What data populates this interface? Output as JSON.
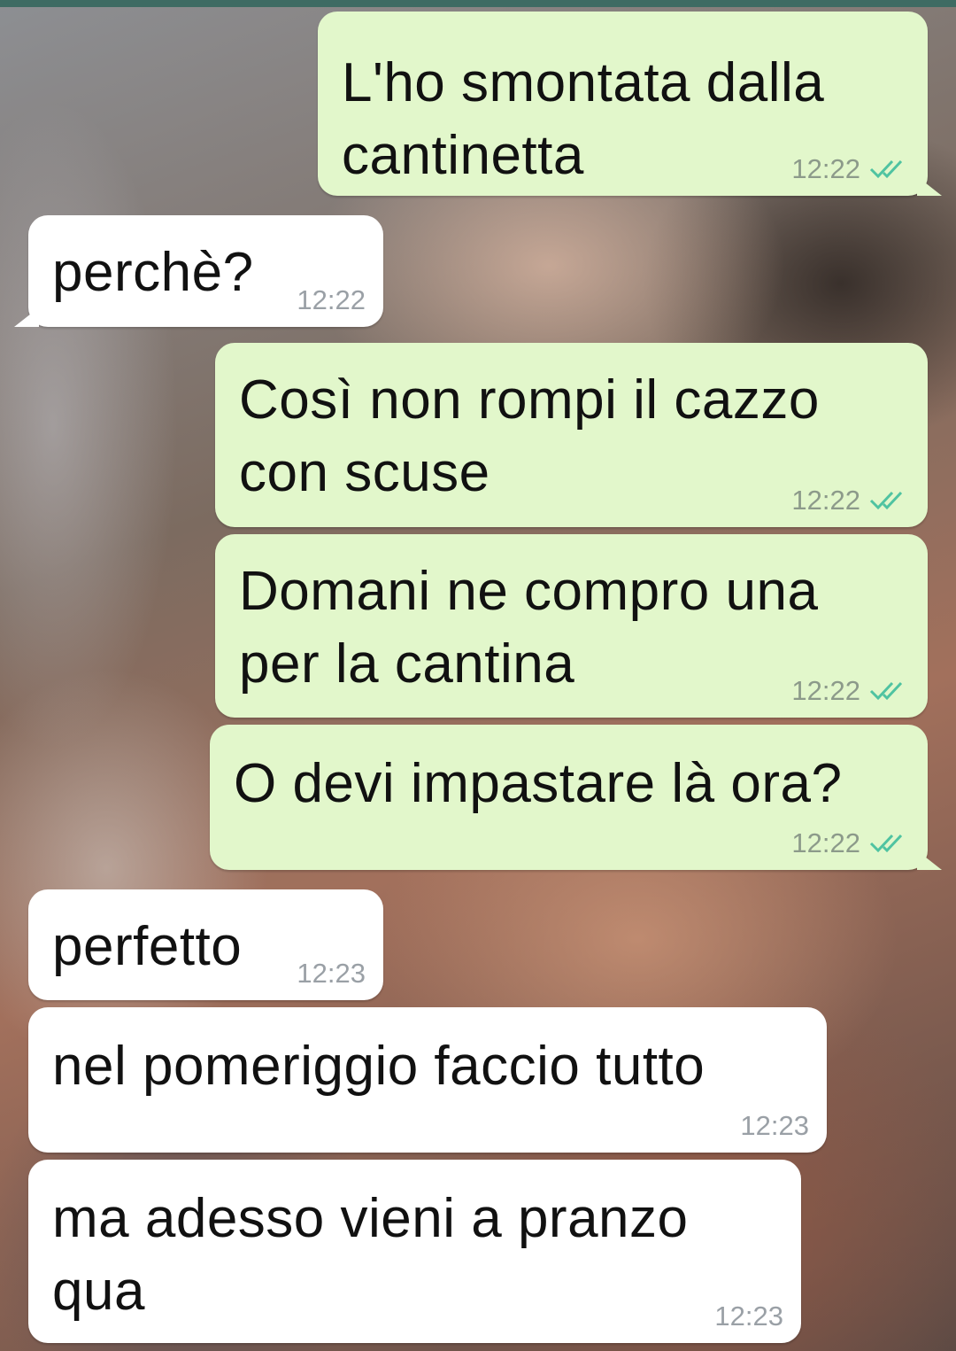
{
  "chat": {
    "messages": [
      {
        "direction": "outgoing",
        "text": "L'ho smontata dalla\ncantinetta",
        "time": "12:22",
        "status": "read-double-check-icon"
      },
      {
        "direction": "incoming",
        "text": "perchè?",
        "time": "12:22"
      },
      {
        "direction": "outgoing",
        "text": "Così non rompi il cazzo\ncon scuse",
        "time": "12:22",
        "status": "read-double-check-icon"
      },
      {
        "direction": "outgoing",
        "text": "Domani ne compro una\nper la cantina",
        "time": "12:22",
        "status": "read-double-check-icon"
      },
      {
        "direction": "outgoing",
        "text": "O devi impastare là ora?",
        "time": "12:22",
        "status": "read-double-check-icon"
      },
      {
        "direction": "incoming",
        "text": "perfetto",
        "time": "12:23"
      },
      {
        "direction": "incoming",
        "text": "nel pomeriggio faccio tutto",
        "time": "12:23"
      },
      {
        "direction": "incoming",
        "text": "ma adesso vieni a pranzo\nqua",
        "time": "12:23"
      }
    ]
  },
  "colors": {
    "outgoing_bubble": "#e2f7cb",
    "incoming_bubble": "#ffffff",
    "read_ticks": "#4fc3a1"
  }
}
